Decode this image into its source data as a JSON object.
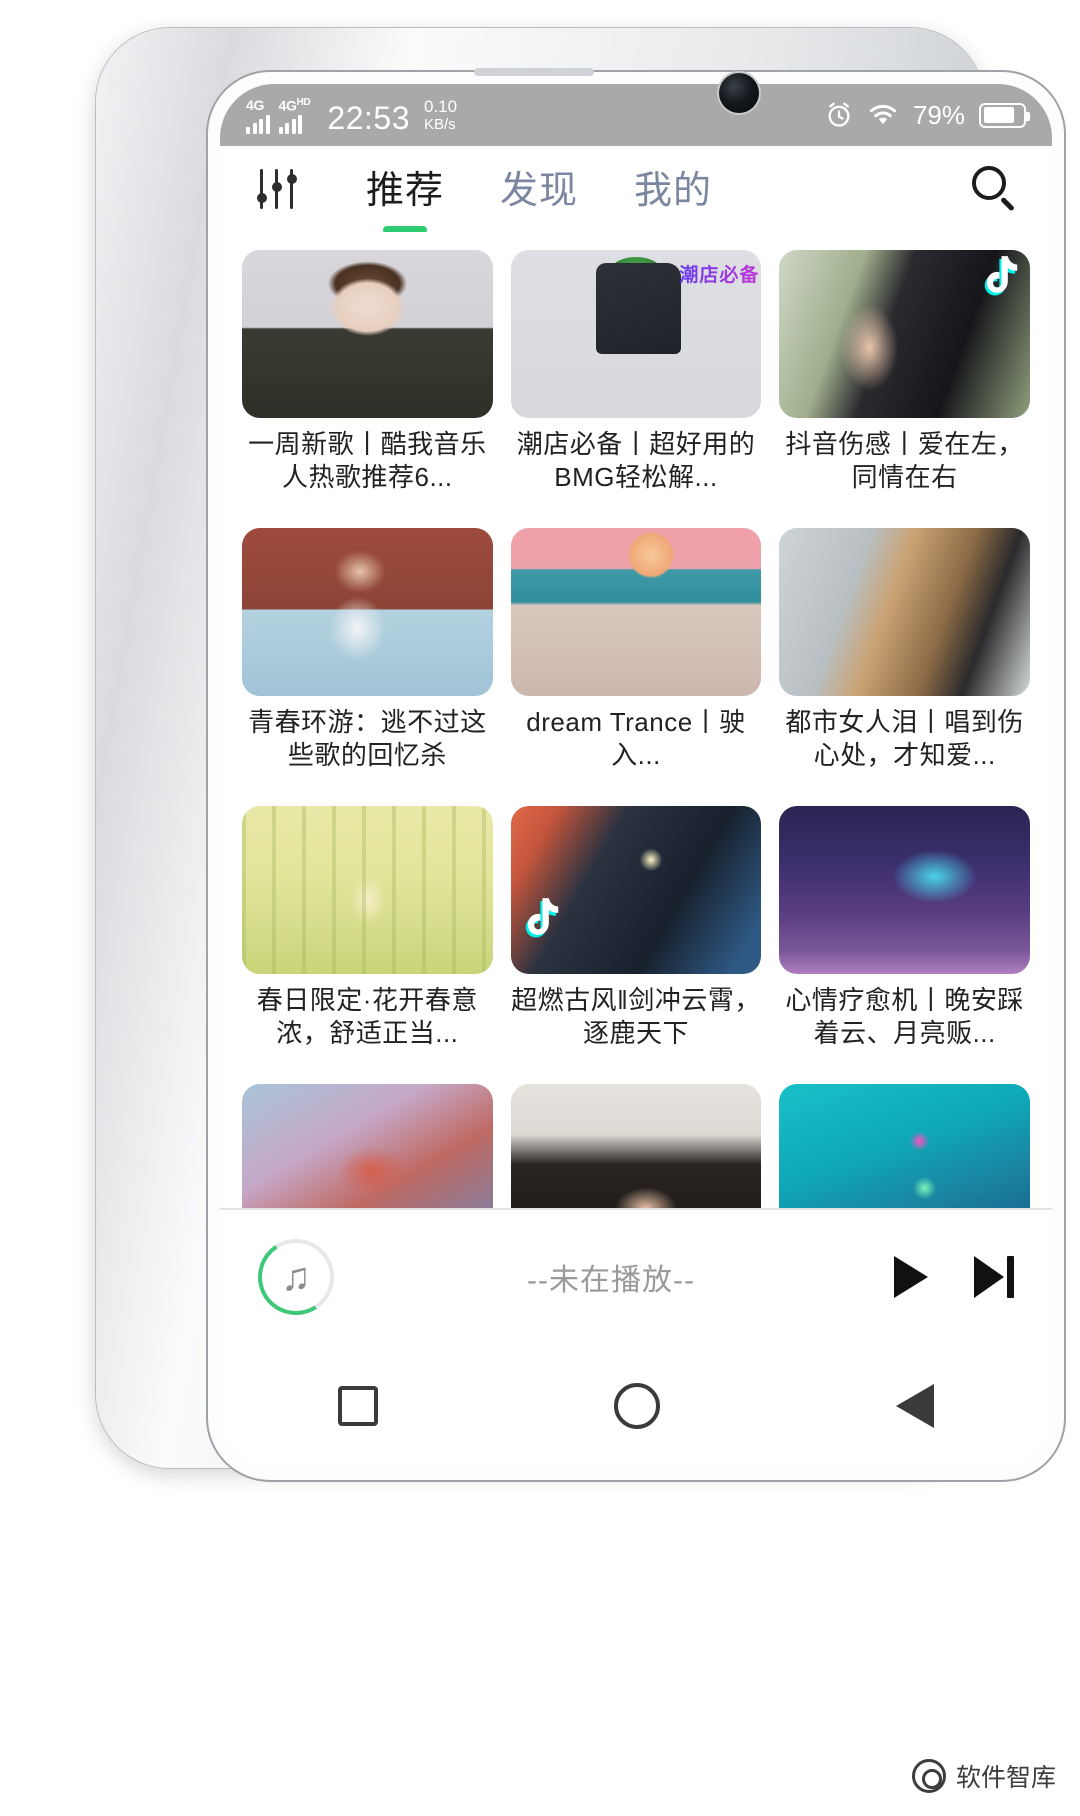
{
  "status_bar": {
    "network_1": "4G",
    "network_2": "4G",
    "network_2_sup": "HD",
    "time": "22:53",
    "data_rate": "0.10",
    "data_unit": "KB/s",
    "alarm_icon": "alarm-icon",
    "wifi_icon": "wifi-icon",
    "battery_percent": "79%"
  },
  "top_bar": {
    "equalizer_icon": "equalizer-icon",
    "search_icon": "search-icon",
    "tabs": [
      {
        "label": "推荐",
        "active": true
      },
      {
        "label": "发现",
        "active": false
      },
      {
        "label": "我的",
        "active": false
      }
    ],
    "active_indicator_color": "#2ecc71"
  },
  "cards": [
    {
      "title": "一周新歌丨酷我音乐人热歌推荐6...",
      "art": "a1",
      "badge": ""
    },
    {
      "title": "潮店必备丨超好用的BMG轻松解...",
      "art": "a2",
      "badge": "",
      "overlay_text": "潮店必备"
    },
    {
      "title": "抖音伤感丨爱在左，同情在右",
      "art": "a3",
      "badge": "tiktok-top-right"
    },
    {
      "title": "青春环游：逃不过这些歌的回忆杀",
      "art": "a4",
      "badge": ""
    },
    {
      "title": "dream Trance丨驶入...",
      "art": "a5",
      "badge": ""
    },
    {
      "title": "都市女人泪丨唱到伤心处，才知爱...",
      "art": "a6",
      "badge": ""
    },
    {
      "title": "春日限定·花开春意浓，舒适正当...",
      "art": "a7",
      "badge": ""
    },
    {
      "title": "超燃古风‖剑冲云霄，逐鹿天下",
      "art": "a8",
      "badge": "tiktok-bottom-left"
    },
    {
      "title": "心情疗愈机丨晚安踩着云、月亮贩...",
      "art": "a9",
      "badge": ""
    },
    {
      "title": "",
      "art": "a10",
      "badge": ""
    },
    {
      "title": "",
      "art": "a11",
      "badge": ""
    },
    {
      "title": "",
      "art": "a12",
      "badge": ""
    }
  ],
  "player": {
    "cover_icon": "music-note-icon",
    "title": "--未在播放--",
    "play_button": "play-button",
    "next_button": "next-track-button"
  },
  "nav_bar": {
    "recents": "square-recents-button",
    "home": "circle-home-button",
    "back": "triangle-back-button"
  },
  "watermark": {
    "text": "软件智库"
  }
}
